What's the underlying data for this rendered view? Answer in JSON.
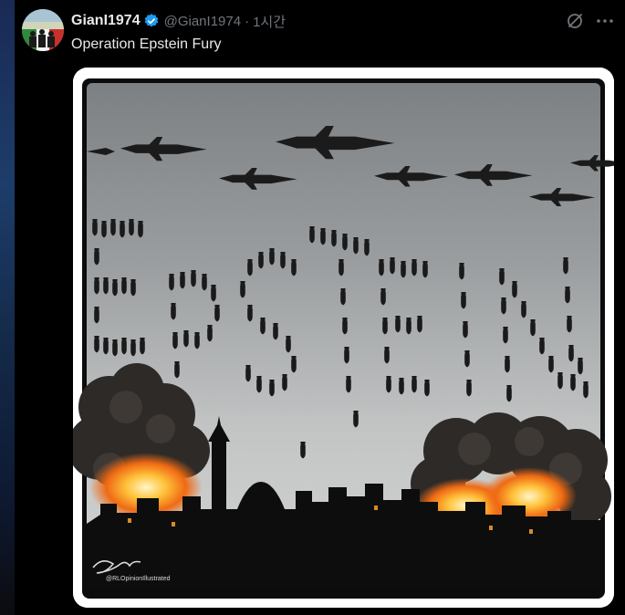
{
  "tweet": {
    "display_name": "GianI1974",
    "handle": "@GianI1974",
    "separator": "·",
    "time": "1시간",
    "text": "Operation Epstein Fury",
    "verified": true
  },
  "icons": {
    "verified": "verified-badge-icon",
    "grok": "grok-icon",
    "more": "more-options-icon"
  },
  "colors": {
    "name": "#e7e9ea",
    "muted": "#71767b",
    "verified": "#1d9bf0",
    "background": "#000000"
  },
  "media": {
    "artist_signature": "@RLOpinionIllustrated"
  }
}
